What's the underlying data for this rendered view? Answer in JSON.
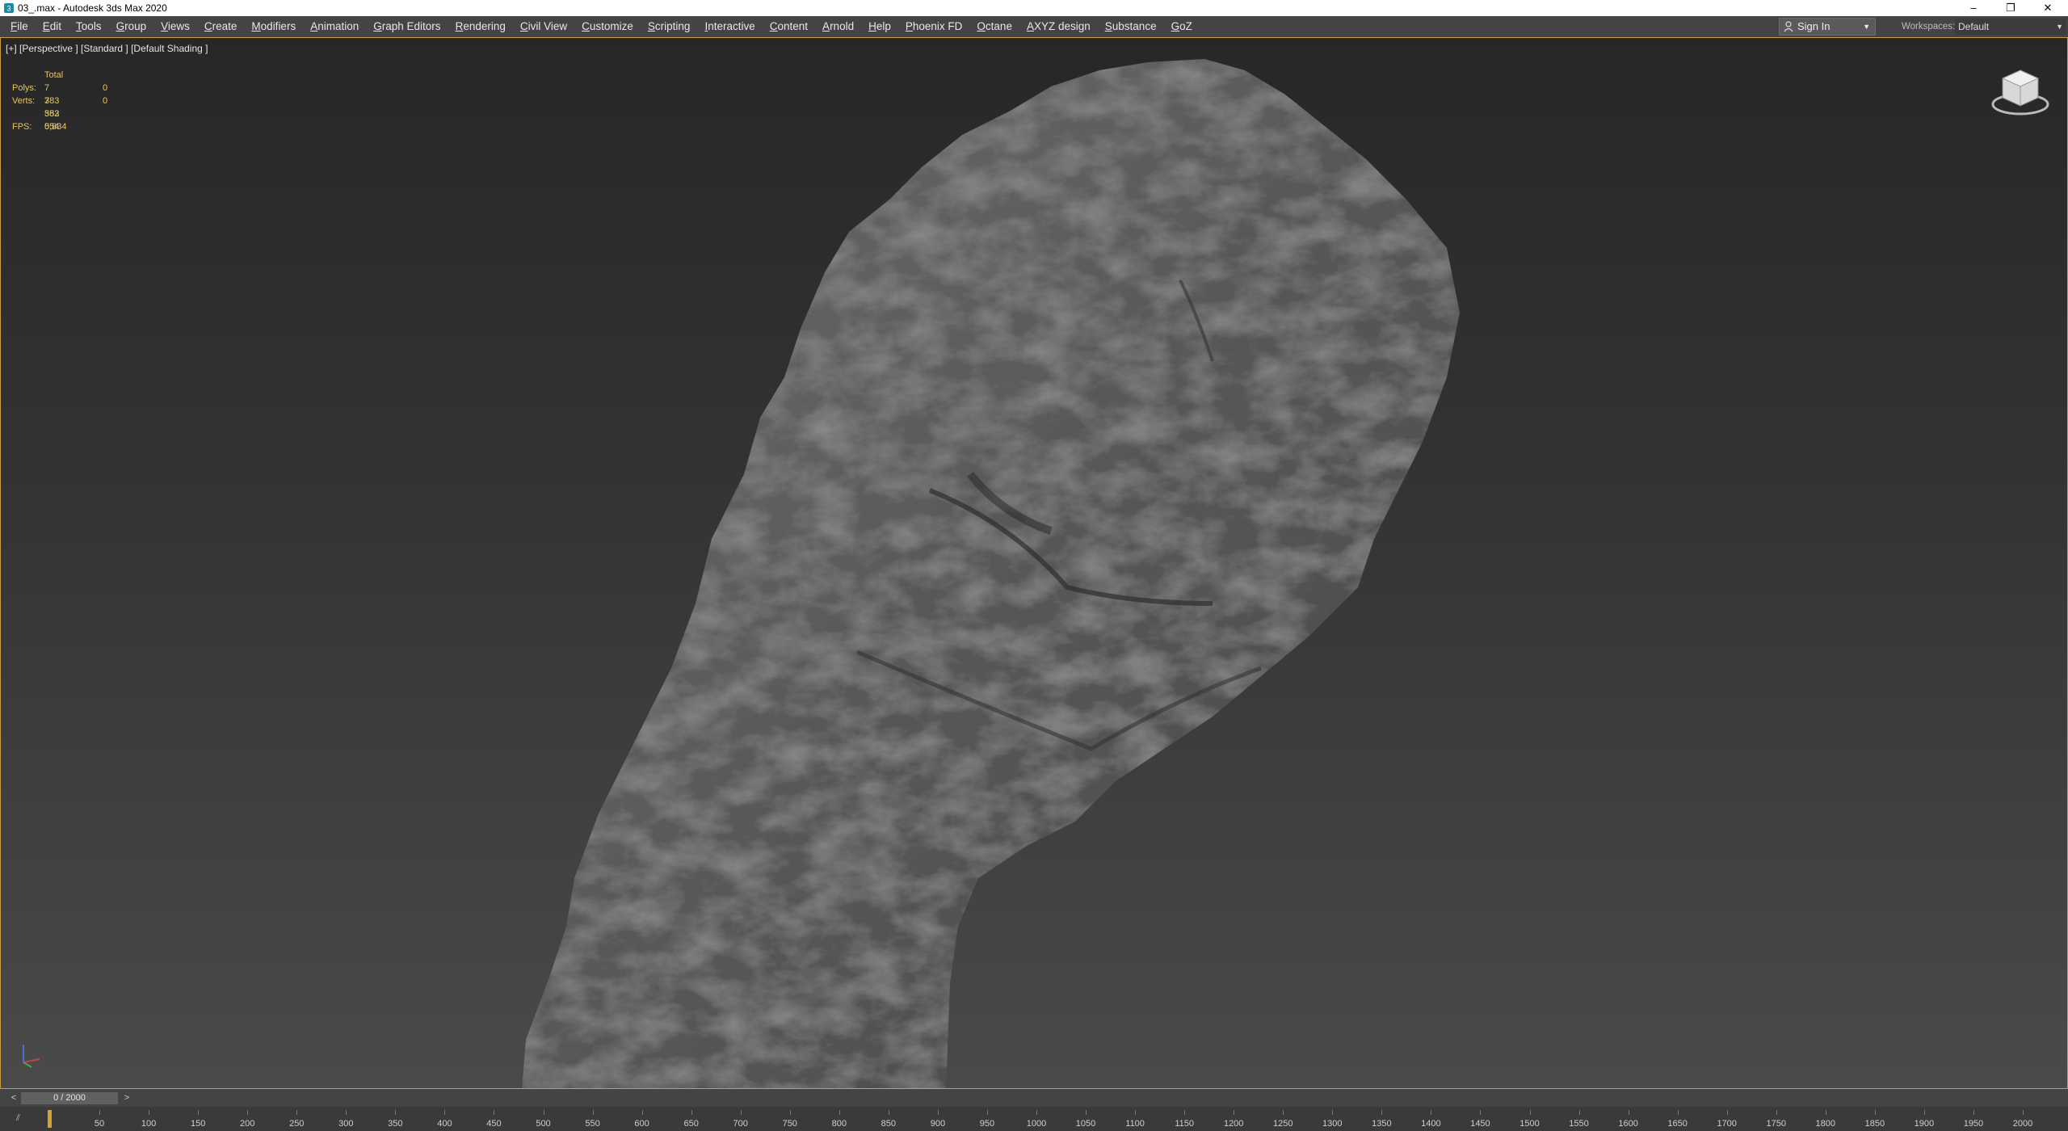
{
  "window": {
    "title": "03_.max - Autodesk 3ds Max 2020",
    "controls": {
      "minimize": "–",
      "restore": "❐",
      "close": "✕"
    }
  },
  "menu": {
    "items": [
      "File",
      "Edit",
      "Tools",
      "Group",
      "Views",
      "Create",
      "Modifiers",
      "Animation",
      "Graph Editors",
      "Rendering",
      "Civil View",
      "Customize",
      "Scripting",
      "Interactive",
      "Content",
      "Arnold",
      "Help",
      "Phoenix FD",
      "Octane",
      "AXYZ design",
      "Substance",
      "GoZ"
    ]
  },
  "signin": {
    "label": "Sign In"
  },
  "workspaces": {
    "label": "Workspaces:",
    "value": "Default"
  },
  "viewport": {
    "label": "[+] [Perspective ] [Standard ] [Default Shading ]",
    "stats": {
      "header": "Total",
      "polys_label": "Polys:",
      "polys_value": "7 383 552",
      "polys_sel": "0",
      "verts_label": "Verts:",
      "verts_value": "7 383 554",
      "verts_sel": "0",
      "fps_label": "FPS:",
      "fps_value": "0,834"
    }
  },
  "timeslider": {
    "frame": "0 / 2000",
    "prev": "<",
    "next": ">",
    "ticks": [
      "50",
      "100",
      "150",
      "200",
      "250",
      "300",
      "350",
      "400",
      "450",
      "500",
      "550",
      "600",
      "650",
      "700",
      "750",
      "800",
      "850",
      "900",
      "950",
      "1000",
      "1050",
      "1100",
      "1150",
      "1200",
      "1250",
      "1300",
      "1350",
      "1400",
      "1450",
      "1500",
      "1550",
      "1600",
      "1650",
      "1700",
      "1750",
      "1800",
      "1850",
      "1900",
      "1950",
      "2000"
    ]
  },
  "colors": {
    "accent": "#e5c85a",
    "viewport_border": "#c8a03c",
    "menubar": "#444444"
  },
  "icons": {
    "app": "3ds-max-icon",
    "user": "user-icon",
    "viewcube": "viewcube-icon",
    "axis": "axis-tripod-icon"
  }
}
